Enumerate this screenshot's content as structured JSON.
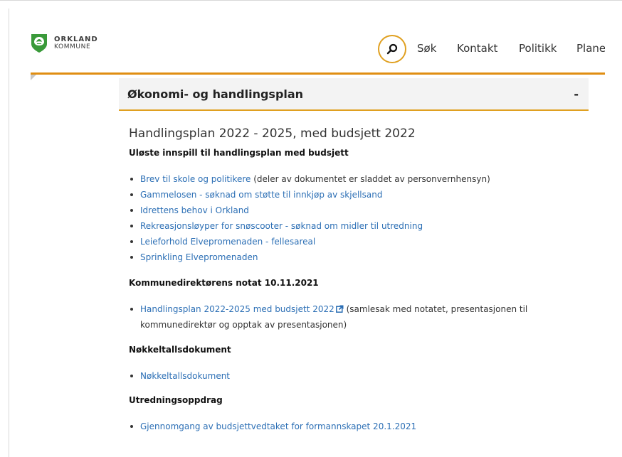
{
  "header": {
    "logo": {
      "line1": "ORKLAND",
      "line2": "KOMMUNE"
    },
    "nav": {
      "search": "Søk",
      "contact": "Kontakt",
      "politics": "Politikk",
      "plan": "Plane"
    }
  },
  "accordion": {
    "title": "Økonomi- og handlingsplan",
    "toggle": "-"
  },
  "main": {
    "heading": "Handlingsplan 2022 - 2025, med budsjett 2022",
    "sections": [
      {
        "title": "Uløste innspill til handlingsplan med budsjett",
        "items": [
          {
            "link": "Brev til skole og politikere",
            "note": " (deler av dokumentet er sladdet av personvernhensyn)"
          },
          {
            "link": "Gammelosen - søknad om støtte til innkjøp av skjellsand",
            "note": ""
          },
          {
            "link": "Idrettens behov i Orkland",
            "note": ""
          },
          {
            "link": "Rekreasjonsløyper for snøscooter - søknad om midler til utredning",
            "note": ""
          },
          {
            "link": "Leieforhold Elvepromenaden - fellesareal",
            "note": ""
          },
          {
            "link": "Sprinkling Elvepromenaden",
            "note": ""
          }
        ]
      },
      {
        "title": "Kommunedirektørens notat 10.11.2021",
        "items": [
          {
            "link": "Handlingsplan 2022-2025 med budsjett 2022",
            "note_line1": " (samlesak med notatet, presentasjonen til",
            "note_line2": "kommunedirektør og opptak av presentasjonen)"
          }
        ]
      },
      {
        "title": "Nøkkeltallsdokument",
        "items": [
          {
            "link": "Nøkkeltallsdokument"
          }
        ]
      },
      {
        "title": "Utredningsoppdrag",
        "items": [
          {
            "link": "Gjennomgang av budsjettvedtaket for formannskapet 20.1.2021"
          }
        ]
      }
    ]
  },
  "colors": {
    "accent": "#e08e12",
    "link": "#2c6fb5",
    "logo_green": "#3a9a3a"
  },
  "icons": {
    "search": "search-icon",
    "external": "external-link-icon",
    "logo": "municipality-shield-icon"
  }
}
